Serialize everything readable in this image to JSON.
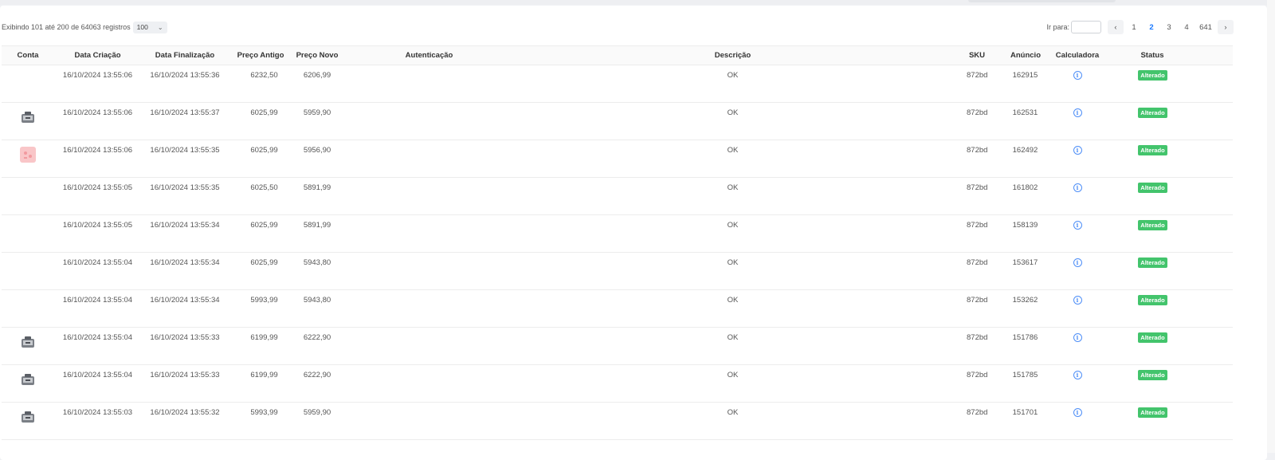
{
  "summary": {
    "records_text": "Exibindo 101 até 200 de 64063 registros",
    "page_size": "100"
  },
  "pagination": {
    "goto_label": "Ir para:",
    "goto_value": "",
    "pages": [
      "1",
      "2",
      "3",
      "4",
      "641"
    ],
    "current_page": "2",
    "prev_icon": "chevron-left-icon",
    "next_icon": "chevron-right-icon"
  },
  "table": {
    "columns": [
      "Conta",
      "Data Criação",
      "Data Finalização",
      "Preço Antigo",
      "Preço Novo",
      "Autenticação",
      "Descrição",
      "SKU",
      "Anúncio",
      "Calculadora",
      "Status"
    ],
    "rows": [
      {
        "account_thumb": "none",
        "created": "16/10/2024 13:55:06",
        "finished": "16/10/2024 13:55:36",
        "old_price": "6232,50",
        "new_price": "6206,99",
        "auth": "",
        "description": "OK",
        "sku": "872bd",
        "listing": "162915",
        "calc_icon": "info-icon",
        "status": "Alterado"
      },
      {
        "account_thumb": "device",
        "created": "16/10/2024 13:55:06",
        "finished": "16/10/2024 13:55:37",
        "old_price": "6025,99",
        "new_price": "5959,90",
        "auth": "",
        "description": "OK",
        "sku": "872bd",
        "listing": "162531",
        "calc_icon": "info-icon",
        "status": "Alterado"
      },
      {
        "account_thumb": "pink",
        "created": "16/10/2024 13:55:06",
        "finished": "16/10/2024 13:55:35",
        "old_price": "6025,99",
        "new_price": "5956,90",
        "auth": "",
        "description": "OK",
        "sku": "872bd",
        "listing": "162492",
        "calc_icon": "info-icon",
        "status": "Alterado"
      },
      {
        "account_thumb": "none",
        "created": "16/10/2024 13:55:05",
        "finished": "16/10/2024 13:55:35",
        "old_price": "6025,50",
        "new_price": "5891,99",
        "auth": "",
        "description": "OK",
        "sku": "872bd",
        "listing": "161802",
        "calc_icon": "info-icon",
        "status": "Alterado"
      },
      {
        "account_thumb": "none",
        "created": "16/10/2024 13:55:05",
        "finished": "16/10/2024 13:55:34",
        "old_price": "6025,99",
        "new_price": "5891,99",
        "auth": "",
        "description": "OK",
        "sku": "872bd",
        "listing": "158139",
        "calc_icon": "info-icon",
        "status": "Alterado"
      },
      {
        "account_thumb": "none",
        "created": "16/10/2024 13:55:04",
        "finished": "16/10/2024 13:55:34",
        "old_price": "6025,99",
        "new_price": "5943,80",
        "auth": "",
        "description": "OK",
        "sku": "872bd",
        "listing": "153617",
        "calc_icon": "info-icon",
        "status": "Alterado"
      },
      {
        "account_thumb": "none",
        "created": "16/10/2024 13:55:04",
        "finished": "16/10/2024 13:55:34",
        "old_price": "5993,99",
        "new_price": "5943,80",
        "auth": "",
        "description": "OK",
        "sku": "872bd",
        "listing": "153262",
        "calc_icon": "info-icon",
        "status": "Alterado"
      },
      {
        "account_thumb": "device",
        "created": "16/10/2024 13:55:04",
        "finished": "16/10/2024 13:55:33",
        "old_price": "6199,99",
        "new_price": "6222,90",
        "auth": "",
        "description": "OK",
        "sku": "872bd",
        "listing": "151786",
        "calc_icon": "info-icon",
        "status": "Alterado"
      },
      {
        "account_thumb": "device",
        "created": "16/10/2024 13:55:04",
        "finished": "16/10/2024 13:55:33",
        "old_price": "6199,99",
        "new_price": "6222,90",
        "auth": "",
        "description": "OK",
        "sku": "872bd",
        "listing": "151785",
        "calc_icon": "info-icon",
        "status": "Alterado"
      },
      {
        "account_thumb": "device",
        "created": "16/10/2024 13:55:03",
        "finished": "16/10/2024 13:55:32",
        "old_price": "5993,99",
        "new_price": "5959,90",
        "auth": "",
        "description": "OK",
        "sku": "872bd",
        "listing": "151701",
        "calc_icon": "info-icon",
        "status": "Alterado"
      }
    ]
  },
  "colors": {
    "accent": "#1677ff",
    "status_success": "#43c46c",
    "info_icon": "#4f8ff7"
  }
}
